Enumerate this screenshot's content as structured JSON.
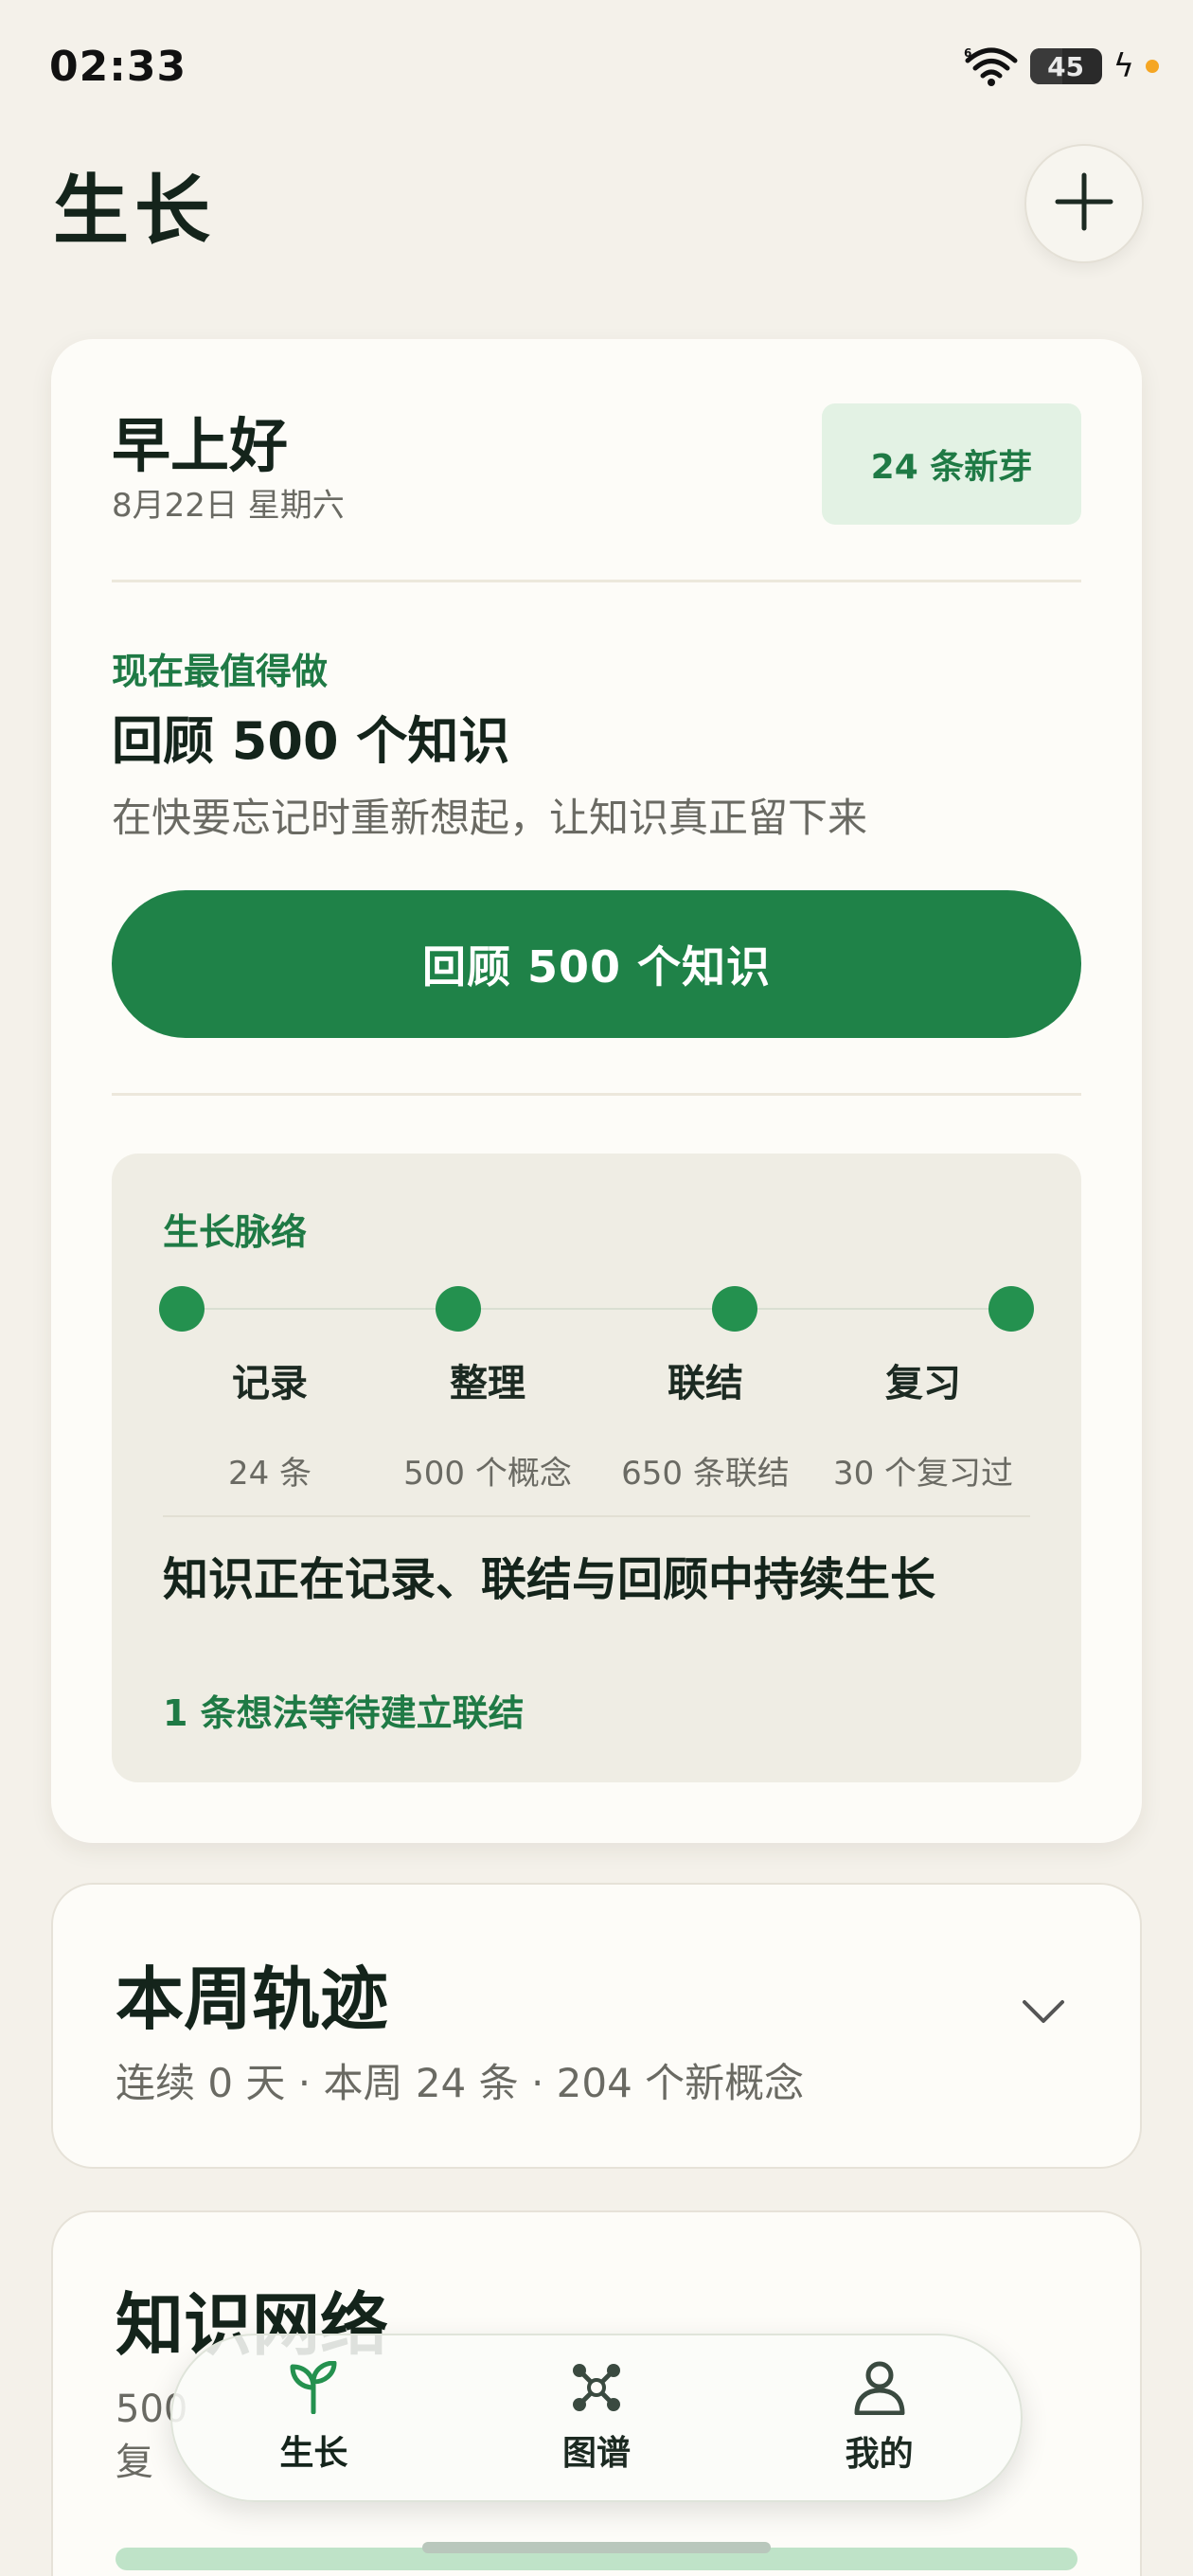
{
  "status_bar": {
    "time": "02:33",
    "battery": "45",
    "battery_level": 0.45,
    "icons": [
      "wifi-6-icon",
      "battery-icon",
      "charging-icon"
    ]
  },
  "header": {
    "title": "生长",
    "add_icon": "plus-icon"
  },
  "today_card": {
    "greeting": "早上好",
    "date": "8月22日 星期六",
    "sprout_badge": "24 条新芽",
    "suggest_label": "现在最值得做",
    "suggest_title": "回顾 500 个知识",
    "suggest_desc": "在快要忘记时重新想起，让知识真正留下来",
    "review_button": "回顾 500 个知识",
    "growth": {
      "label": "生长脉络",
      "steps": [
        {
          "name": "记录",
          "count": "24 条"
        },
        {
          "name": "整理",
          "count": "500 个概念"
        },
        {
          "name": "联结",
          "count": "650 条联结"
        },
        {
          "name": "复习",
          "count": "30 个复习过"
        }
      ],
      "headline": "知识正在记录、联结与回顾中持续生长",
      "note": "1 条想法等待建立联结"
    }
  },
  "week_card": {
    "title": "本周轨迹",
    "stats": "连续 0 天 · 本周 24 条 · 204 个新概念"
  },
  "network_card": {
    "title": "知识网络",
    "text_line1": "500",
    "text_line2": "复"
  },
  "bottom_nav": {
    "items": [
      {
        "label": "生长",
        "icon": "sprout-icon",
        "active": true
      },
      {
        "label": "图谱",
        "icon": "graph-icon",
        "active": false
      },
      {
        "label": "我的",
        "icon": "person-icon",
        "active": false
      }
    ]
  },
  "colors": {
    "accent": "#1f8248",
    "accent_text": "#1f7a45",
    "background": "#f4f1ea",
    "card": "#fdfcf8"
  }
}
